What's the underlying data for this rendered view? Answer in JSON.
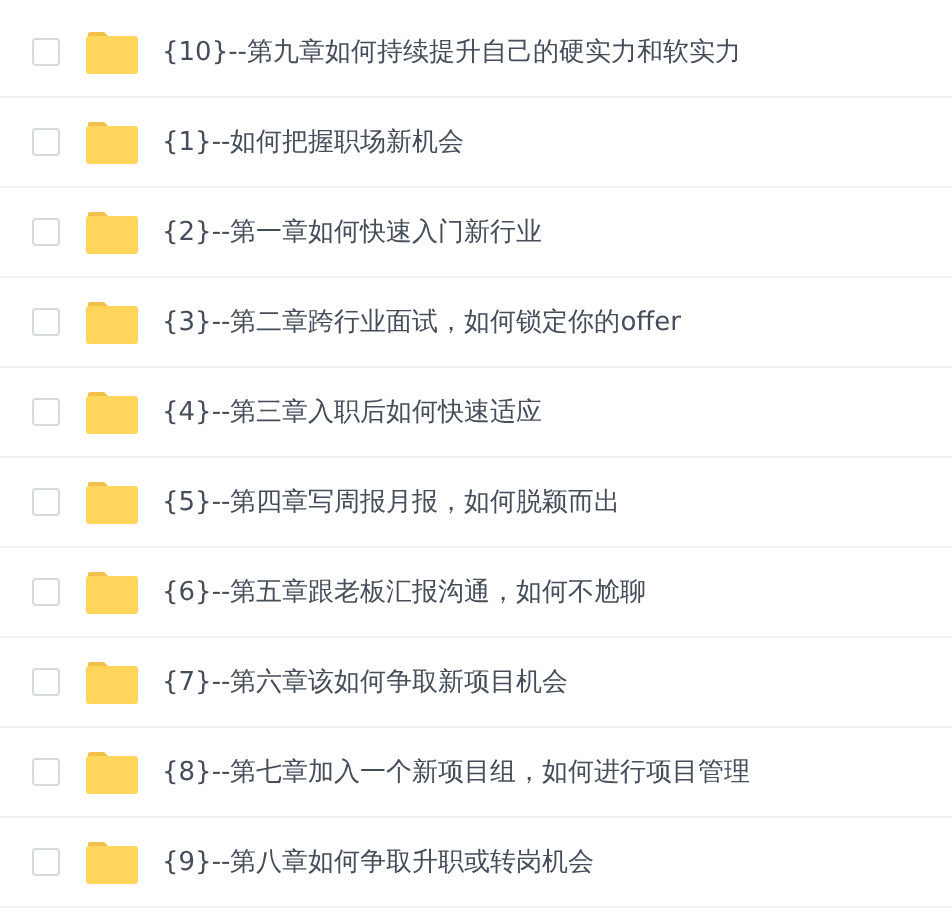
{
  "files": [
    {
      "name": "{10}--第九章如何持续提升自己的硬实力和软实力",
      "checked": false
    },
    {
      "name": "{1}--如何把握职场新机会",
      "checked": false
    },
    {
      "name": "{2}--第一章如何快速入门新行业",
      "checked": false
    },
    {
      "name": "{3}--第二章跨行业面试，如何锁定你的offer",
      "checked": false
    },
    {
      "name": "{4}--第三章入职后如何快速适应",
      "checked": false
    },
    {
      "name": "{5}--第四章写周报月报，如何脱颖而出",
      "checked": false
    },
    {
      "name": "{6}--第五章跟老板汇报沟通，如何不尬聊",
      "checked": false
    },
    {
      "name": "{7}--第六章该如何争取新项目机会",
      "checked": false
    },
    {
      "name": "{8}--第七章加入一个新项目组，如何进行项目管理",
      "checked": false
    },
    {
      "name": "{9}--第八章如何争取升职或转岗机会",
      "checked": false
    }
  ]
}
